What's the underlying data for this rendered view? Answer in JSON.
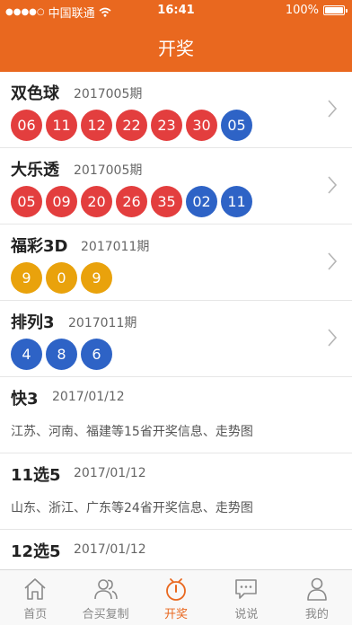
{
  "status_bar": {
    "signal": "●●●●○",
    "carrier": "中国联通",
    "time": "16:41",
    "battery": "100%"
  },
  "header": {
    "title": "开奖"
  },
  "lotteries": [
    {
      "name": "双色球",
      "period": "2017005期",
      "balls": [
        {
          "n": "06",
          "c": "red"
        },
        {
          "n": "11",
          "c": "red"
        },
        {
          "n": "12",
          "c": "red"
        },
        {
          "n": "22",
          "c": "red"
        },
        {
          "n": "23",
          "c": "red"
        },
        {
          "n": "30",
          "c": "red"
        },
        {
          "n": "05",
          "c": "blue"
        }
      ]
    },
    {
      "name": "大乐透",
      "period": "2017005期",
      "balls": [
        {
          "n": "05",
          "c": "red"
        },
        {
          "n": "09",
          "c": "red"
        },
        {
          "n": "20",
          "c": "red"
        },
        {
          "n": "26",
          "c": "red"
        },
        {
          "n": "35",
          "c": "red"
        },
        {
          "n": "02",
          "c": "blue"
        },
        {
          "n": "11",
          "c": "blue"
        }
      ]
    },
    {
      "name": "福彩3D",
      "period": "2017011期",
      "balls": [
        {
          "n": "9",
          "c": "gold"
        },
        {
          "n": "0",
          "c": "gold"
        },
        {
          "n": "9",
          "c": "gold"
        }
      ]
    },
    {
      "name": "排列3",
      "period": "2017011期",
      "balls": [
        {
          "n": "4",
          "c": "blue"
        },
        {
          "n": "8",
          "c": "blue"
        },
        {
          "n": "6",
          "c": "blue"
        }
      ]
    }
  ],
  "text_items": [
    {
      "name": "快3",
      "date": "2017/01/12",
      "desc": "江苏、河南、福建等15省开奖信息、走势图"
    },
    {
      "name": "11选5",
      "date": "2017/01/12",
      "desc": "山东、浙江、广东等24省开奖信息、走势图"
    },
    {
      "name": "12选5",
      "date": "2017/01/12",
      "desc": ""
    }
  ],
  "tabs": [
    {
      "label": "首页",
      "icon": "home-icon"
    },
    {
      "label": "合买复制",
      "icon": "users-icon"
    },
    {
      "label": "开奖",
      "icon": "draw-clock-icon",
      "active": true
    },
    {
      "label": "说说",
      "icon": "chat-icon"
    },
    {
      "label": "我的",
      "icon": "person-icon"
    }
  ],
  "colors": {
    "brand": "#e9681f",
    "red_ball": "#e33e3e",
    "blue_ball": "#2e63c6",
    "gold_ball": "#e9a20c"
  }
}
